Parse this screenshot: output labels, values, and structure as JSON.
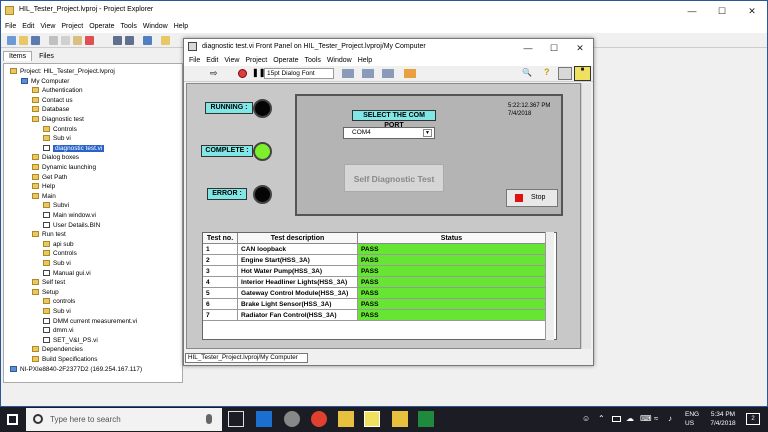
{
  "project_explorer": {
    "title": "HIL_Tester_Project.lvproj - Project Explorer",
    "menu": [
      "File",
      "Edit",
      "View",
      "Project",
      "Operate",
      "Tools",
      "Window",
      "Help"
    ],
    "tabs": [
      "Items",
      "Files"
    ],
    "tree": [
      {
        "label": "Project: HIL_Tester_Project.lvproj",
        "depth": 0,
        "icon": "project"
      },
      {
        "label": "My Computer",
        "depth": 1,
        "icon": "computer"
      },
      {
        "label": "Authentication",
        "depth": 2,
        "icon": "folder"
      },
      {
        "label": "Contact us",
        "depth": 2,
        "icon": "folder"
      },
      {
        "label": "Database",
        "depth": 2,
        "icon": "folder"
      },
      {
        "label": "Diagnostic test",
        "depth": 2,
        "icon": "folder"
      },
      {
        "label": "Controls",
        "depth": 3,
        "icon": "folder"
      },
      {
        "label": "Sub vi",
        "depth": 3,
        "icon": "folder"
      },
      {
        "label": "diagnostic test.vi",
        "depth": 3,
        "icon": "vi",
        "selected": true
      },
      {
        "label": "Dialog boxes",
        "depth": 2,
        "icon": "folder"
      },
      {
        "label": "Dynamic launching",
        "depth": 2,
        "icon": "folder"
      },
      {
        "label": "Get Path",
        "depth": 2,
        "icon": "folder"
      },
      {
        "label": "Help",
        "depth": 2,
        "icon": "folder"
      },
      {
        "label": "Main",
        "depth": 2,
        "icon": "folder"
      },
      {
        "label": "Subvi",
        "depth": 3,
        "icon": "folder"
      },
      {
        "label": "Main window.vi",
        "depth": 3,
        "icon": "vi"
      },
      {
        "label": "User Details.BIN",
        "depth": 3,
        "icon": "vi"
      },
      {
        "label": "Run test",
        "depth": 2,
        "icon": "folder"
      },
      {
        "label": "api sub",
        "depth": 3,
        "icon": "folder"
      },
      {
        "label": "Controls",
        "depth": 3,
        "icon": "folder"
      },
      {
        "label": "Sub vi",
        "depth": 3,
        "icon": "folder"
      },
      {
        "label": "Manual gui.vi",
        "depth": 3,
        "icon": "vi"
      },
      {
        "label": "Self test",
        "depth": 2,
        "icon": "folder"
      },
      {
        "label": "Setup",
        "depth": 2,
        "icon": "folder"
      },
      {
        "label": "controls",
        "depth": 3,
        "icon": "folder"
      },
      {
        "label": "Sub vi",
        "depth": 3,
        "icon": "folder"
      },
      {
        "label": "DMM current measurement.vi",
        "depth": 3,
        "icon": "vi"
      },
      {
        "label": "dmm.vi",
        "depth": 3,
        "icon": "vi"
      },
      {
        "label": "SET_V&I_PS.vi",
        "depth": 3,
        "icon": "vi"
      },
      {
        "label": "Dependencies",
        "depth": 2,
        "icon": "folder"
      },
      {
        "label": "Build Specifications",
        "depth": 2,
        "icon": "folder"
      },
      {
        "label": "NI-PXIe8840-2F2377D2 (169.254.167.117)",
        "depth": 0,
        "icon": "computer"
      }
    ]
  },
  "front_panel": {
    "title": "diagnostic test.vi Front Panel on HIL_Tester_Project.lvproj/My Computer",
    "menu": [
      "File",
      "Edit",
      "View",
      "Project",
      "Operate",
      "Tools",
      "Window",
      "Help"
    ],
    "font_select": "15pt Dialog Font",
    "status_path": "HIL_Tester_Project.lvproj/My Computer",
    "indicators": {
      "running_label": "RUNNING :",
      "complete_label": "COMPLETE :",
      "error_label": "ERROR :",
      "running_color": "#050505",
      "complete_color": "#7cf02a",
      "error_color": "#050505"
    },
    "com_port": {
      "label": "SELECT THE COM PORT",
      "value": "COM4"
    },
    "self_diag_button": "Self Diagnostic Test",
    "datetime": {
      "time": "5:22:12.367 PM",
      "date": "7/4/2018"
    },
    "stop_button": "Stop",
    "table": {
      "headers": [
        "Test no.",
        "Test description",
        "Status"
      ],
      "rows": [
        [
          "1",
          "CAN loopback",
          "PASS"
        ],
        [
          "2",
          "Engine Start(HSS_3A)",
          "PASS"
        ],
        [
          "3",
          "Hot Water Pump(HSS_3A)",
          "PASS"
        ],
        [
          "4",
          "Interior Headliner Lights(HSS_3A)",
          "PASS"
        ],
        [
          "5",
          "Gateway Control Module(HSS_3A)",
          "PASS"
        ],
        [
          "6",
          "Brake Light Sensor(HSS_3A)",
          "PASS"
        ],
        [
          "7",
          "Radiator Fan Control(HSS_3A)",
          "PASS"
        ]
      ]
    }
  },
  "taskbar": {
    "search_placeholder": "Type here to search",
    "lang": "ENG",
    "region": "US",
    "time": "5:34 PM",
    "date": "7/4/2018",
    "notification_count": "2"
  },
  "colors": {
    "pass": "#66e633",
    "label_bg": "#80e6e6",
    "panel_bg": "#c8c8c8"
  }
}
